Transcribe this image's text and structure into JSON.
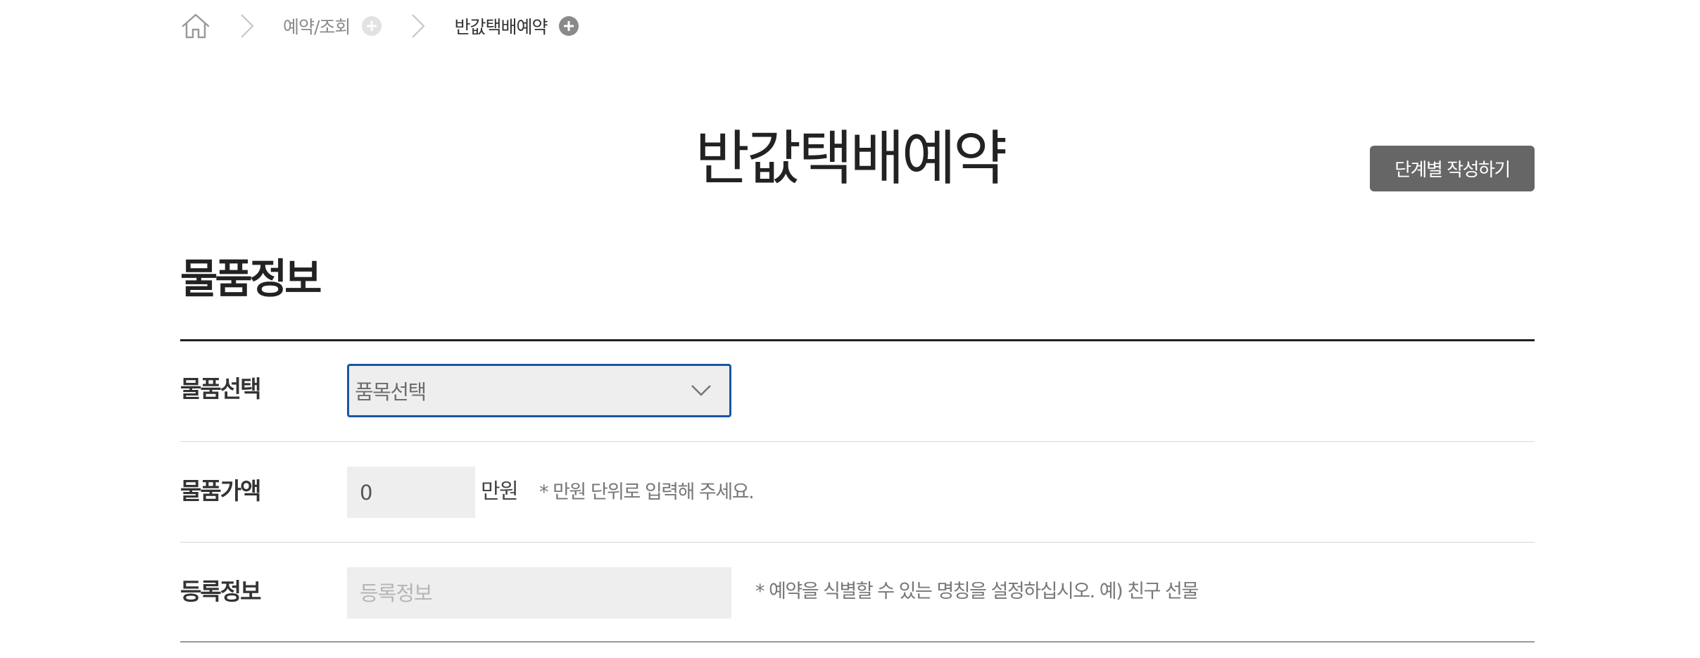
{
  "breadcrumb": {
    "items": [
      {
        "label": "예약/조회"
      },
      {
        "label": "반값택배예약"
      }
    ]
  },
  "header": {
    "title": "반값택배예약",
    "step_button_label": "단계별 작성하기"
  },
  "section": {
    "title": "물품정보",
    "rows": {
      "item_select": {
        "label": "물품선택",
        "selected_value": "품목선택"
      },
      "item_price": {
        "label": "물품가액",
        "value": "0",
        "unit": "만원",
        "hint": "* 만원 단위로 입력해 주세요."
      },
      "registration": {
        "label": "등록정보",
        "placeholder": "등록정보",
        "hint": "* 예약을 식별할 수 있는 명칭을 설정하십시오. 예) 친구 선물"
      }
    }
  },
  "colors": {
    "select_border": "#1a55a6",
    "button_bg": "#666666",
    "input_bg": "#eeeeee"
  }
}
